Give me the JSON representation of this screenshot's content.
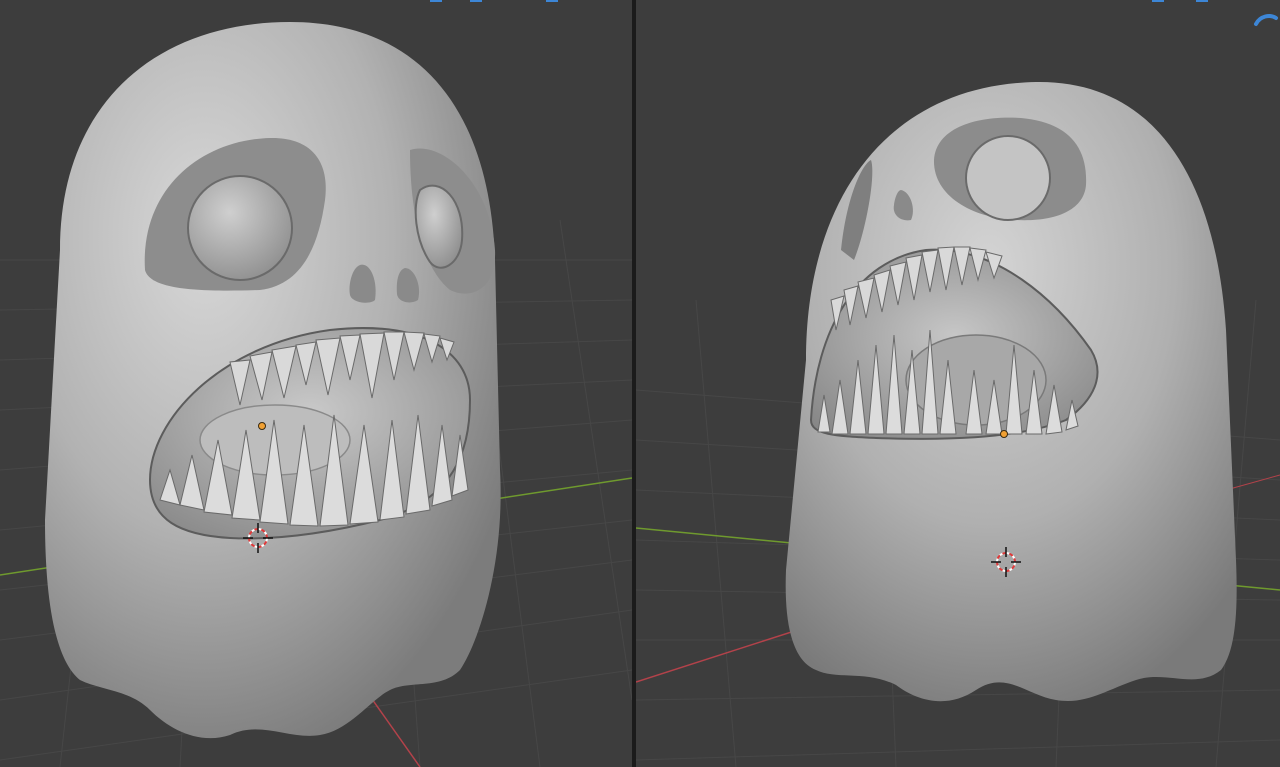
{
  "app": {
    "viewports": [
      {
        "id": "left",
        "view": "perspective-front-three-quarter"
      },
      {
        "id": "right",
        "view": "perspective-side-three-quarter"
      }
    ]
  },
  "colors": {
    "viewport_bg": "#3d3d3d",
    "grid_line": "#4a4a4a",
    "axis_x": "#b3424a",
    "axis_y": "#6f9a2e",
    "model_base": "#a9a9a9",
    "model_highlight": "#d6d6d6",
    "model_shadow": "#6a6a6a",
    "origin_dot": "#f0a033",
    "cursor_red": "#e03a3a",
    "divider": "#1b1b1b",
    "header_accent": "#3d86d6"
  },
  "icons": {
    "cursor": "3d-cursor-icon",
    "origin": "object-origin-icon",
    "nav": "navigation-gizmo-icon"
  }
}
